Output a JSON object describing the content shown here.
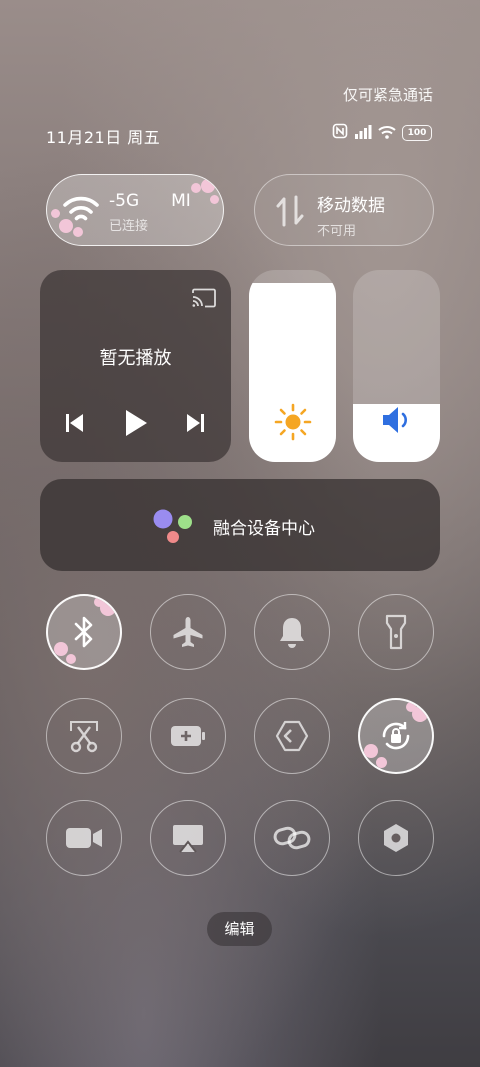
{
  "status_bar": {
    "emergency_text": "仅可紧急通话",
    "date_text": "11月21日 周五",
    "battery_level": "100",
    "icons": [
      "nfc-icon",
      "signal-icon",
      "wifi-icon",
      "battery-icon"
    ]
  },
  "wifi_tile": {
    "name": "-5G",
    "name_suffix": "MI",
    "status": "已连接",
    "active": true
  },
  "data_tile": {
    "title": "移动数据",
    "status": "不可用",
    "active": false
  },
  "media": {
    "title": "暂无播放",
    "icons": [
      "cast-icon",
      "prev-icon",
      "play-icon",
      "next-icon"
    ]
  },
  "brightness": {
    "level": 0.93,
    "icon": "sun-icon"
  },
  "volume": {
    "level": 0.3,
    "icon": "speaker-icon"
  },
  "fusion_center": {
    "label": "融合设备中心",
    "icon": "fusion-devices-icon"
  },
  "toggles": [
    {
      "name": "bluetooth",
      "icon": "bluetooth-icon",
      "active": true
    },
    {
      "name": "airplane",
      "icon": "airplane-icon",
      "active": false
    },
    {
      "name": "silent",
      "icon": "bell-icon",
      "active": false
    },
    {
      "name": "flashlight",
      "icon": "flashlight-icon",
      "active": false
    },
    {
      "name": "screenshot",
      "icon": "scissors-icon",
      "active": false
    },
    {
      "name": "battery-saver",
      "icon": "battery-plus-icon",
      "active": false
    },
    {
      "name": "hop",
      "icon": "diamond-arrow-icon",
      "active": false
    },
    {
      "name": "rotation-lock",
      "icon": "rotation-lock-icon",
      "active": true
    },
    {
      "name": "screen-record",
      "icon": "video-icon",
      "active": false
    },
    {
      "name": "screen-cast",
      "icon": "airplay-icon",
      "active": false
    },
    {
      "name": "link",
      "icon": "link-icon",
      "active": false
    },
    {
      "name": "settings",
      "icon": "hexagon-icon",
      "active": false
    }
  ],
  "edit_button": {
    "label": "编辑"
  },
  "colors": {
    "sun": "#f5a623",
    "speaker": "#2f6fe0",
    "fusion_purple": "#9a8cf0",
    "fusion_green": "#9ee08a",
    "fusion_red": "#f08a8a",
    "petal": "#f2c6d8"
  }
}
